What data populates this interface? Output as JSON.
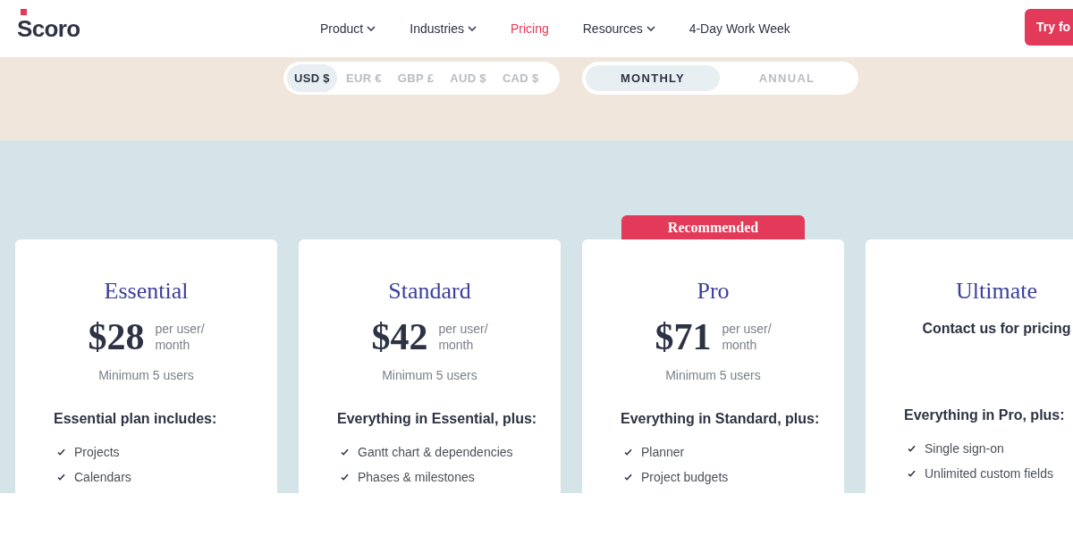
{
  "header": {
    "logo": "Scoro",
    "nav": [
      {
        "label": "Product",
        "selected": false,
        "has_dropdown": true
      },
      {
        "label": "Industries",
        "selected": false,
        "has_dropdown": true
      },
      {
        "label": "Pricing",
        "selected": true,
        "has_dropdown": false
      },
      {
        "label": "Resources",
        "selected": false,
        "has_dropdown": true
      },
      {
        "label": "4-Day Work Week",
        "selected": false,
        "has_dropdown": false
      }
    ],
    "cta": "Try fo"
  },
  "currencies": [
    {
      "label": "USD $",
      "selected": true
    },
    {
      "label": "EUR €",
      "selected": false
    },
    {
      "label": "GBP £",
      "selected": false
    },
    {
      "label": "AUD $",
      "selected": false
    },
    {
      "label": "CAD $",
      "selected": false
    }
  ],
  "billing": [
    {
      "label": "MONTHLY",
      "selected": true
    },
    {
      "label": "ANNUAL",
      "selected": false
    }
  ],
  "plans": [
    {
      "kind": "priced",
      "name": "Essential",
      "price": "$28",
      "unit_line1": "per user/",
      "unit_line2": "month",
      "minimum": "Minimum 5 users",
      "includes": "Essential plan includes:",
      "features": [
        "Projects",
        "Calendars"
      ]
    },
    {
      "kind": "priced",
      "name": "Standard",
      "price": "$42",
      "unit_line1": "per user/",
      "unit_line2": "month",
      "minimum": "Minimum 5 users",
      "includes": "Everything in Essential, plus:",
      "features": [
        "Gantt chart & dependencies",
        "Phases & milestones"
      ]
    },
    {
      "kind": "priced",
      "name": "Pro",
      "badge": "Recommended",
      "price": "$71",
      "unit_line1": "per user/",
      "unit_line2": "month",
      "minimum": "Minimum 5 users",
      "includes": "Everything in Standard, plus:",
      "features": [
        "Planner",
        "Project budgets"
      ]
    },
    {
      "kind": "contact",
      "name": "Ultimate",
      "contact": "Contact us for pricing",
      "includes": "Everything in Pro, plus:",
      "features": [
        "Single sign-on",
        "Unlimited custom fields"
      ]
    }
  ]
}
